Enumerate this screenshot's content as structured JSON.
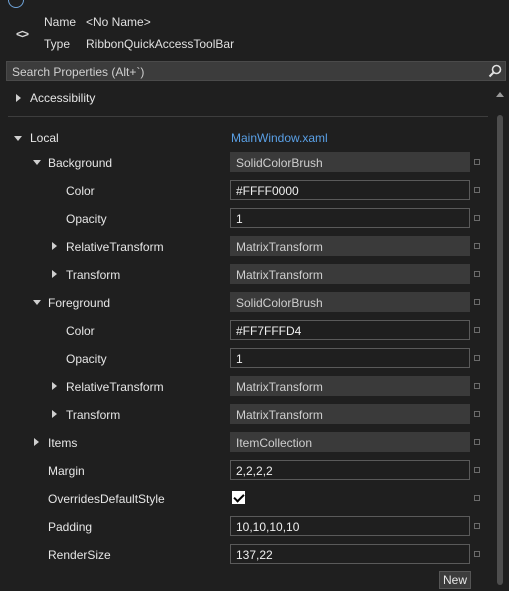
{
  "header": {
    "name_label": "Name",
    "name_value": "<No Name>",
    "type_label": "Type",
    "type_value": "RibbonQuickAccessToolBar"
  },
  "search": {
    "placeholder": "Search Properties (Alt+`)"
  },
  "categories": {
    "accessibility": "Accessibility",
    "local": "Local",
    "local_source": "MainWindow.xaml"
  },
  "properties": {
    "background": {
      "label": "Background",
      "value": "SolidColorBrush"
    },
    "background_color": {
      "label": "Color",
      "value": "#FFFF0000"
    },
    "background_opacity": {
      "label": "Opacity",
      "value": "1"
    },
    "background_relative_transform": {
      "label": "RelativeTransform",
      "value": "MatrixTransform"
    },
    "background_transform": {
      "label": "Transform",
      "value": "MatrixTransform"
    },
    "foreground": {
      "label": "Foreground",
      "value": "SolidColorBrush"
    },
    "foreground_color": {
      "label": "Color",
      "value": "#FF7FFFD4"
    },
    "foreground_opacity": {
      "label": "Opacity",
      "value": "1"
    },
    "foreground_relative_transform": {
      "label": "RelativeTransform",
      "value": "MatrixTransform"
    },
    "foreground_transform": {
      "label": "Transform",
      "value": "MatrixTransform"
    },
    "items": {
      "label": "Items",
      "value": "ItemCollection"
    },
    "margin": {
      "label": "Margin",
      "value": "2,2,2,2"
    },
    "overrides_default_style": {
      "label": "OverridesDefaultStyle",
      "checked": true
    },
    "padding": {
      "label": "Padding",
      "value": "10,10,10,10"
    },
    "render_size": {
      "label": "RenderSize",
      "value": "137,22"
    }
  },
  "buttons": {
    "new_label": "New"
  },
  "icons": {
    "header": "code-brackets-icon",
    "search": "search-icon"
  },
  "colors": {
    "background": "#1f1f1f",
    "link": "#5aa0e6",
    "readonly_field": "#3a3a3a"
  }
}
